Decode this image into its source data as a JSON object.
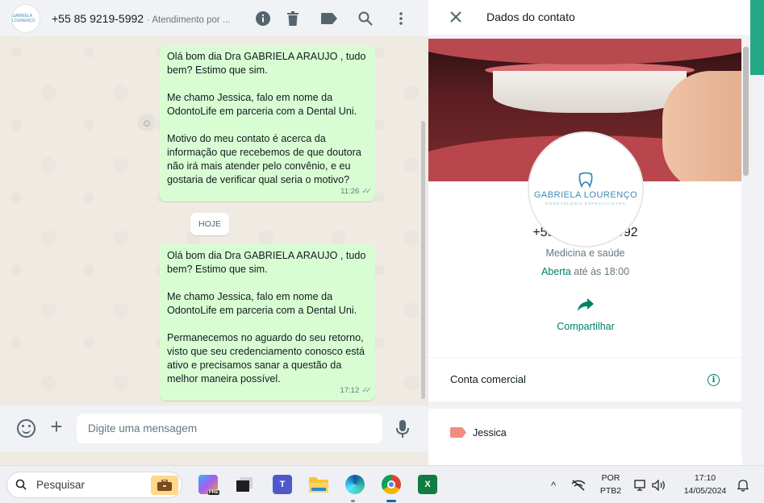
{
  "chat": {
    "avatar_text": "GABRIELA LOURENÇO",
    "contact_number": "+55 85 9219-5992",
    "contact_sub": "· Atendimento por ...",
    "messages": [
      {
        "paragraphs": [
          "Olá bom dia Dra GABRIELA ARAUJO , tudo bem? Estimo que sim.",
          "Me chamo Jessica, falo em nome da OdontoLife em parceria com a Dental Uni.",
          "Motivo do meu contato é acerca da informação que recebemos de que doutora não irá mais atender pelo convênio, e eu gostaria de verificar qual seria o motivo?"
        ],
        "time": "11:26"
      },
      {
        "paragraphs": [
          "Olá bom dia Dra GABRIELA ARAUJO , tudo bem? Estimo que sim.",
          "Me chamo Jessica, falo em nome da OdontoLife em parceria com a Dental Uni.",
          "Permanecemos no aguardo do seu retorno, visto que seu credenciamento conosco está ativo e precisamos sanar a questão da melhor maneira possível."
        ],
        "time": "17:12"
      }
    ],
    "date_divider": "HOJE",
    "composer_placeholder": "Digite uma mensagem"
  },
  "contact_info": {
    "title": "Dados do contato",
    "logo_name": "GABRIELA LOURENÇO",
    "logo_tagline": "ODONTOLOGIA ESPECIALIZADA",
    "phone": "+55 85 9219-5992",
    "category": "Medicina e saúde",
    "hours_status": "Aberta",
    "hours_rest": " até às 18:00",
    "share_label": "Compartilhar",
    "business_account_label": "Conta comercial",
    "label_name": "Jessica"
  },
  "taskbar": {
    "search_placeholder": "Pesquisar",
    "copilot_badge": "PRE",
    "language": "POR",
    "keyboard": "PTB2",
    "time": "17:10",
    "date": "14/05/2024"
  },
  "colors": {
    "outgoing_bubble": "#d9fdd3",
    "accent_green": "#008069",
    "chat_bg": "#efeae2",
    "panel_bg": "#f0f2f5",
    "label_color": "#f28b82"
  }
}
